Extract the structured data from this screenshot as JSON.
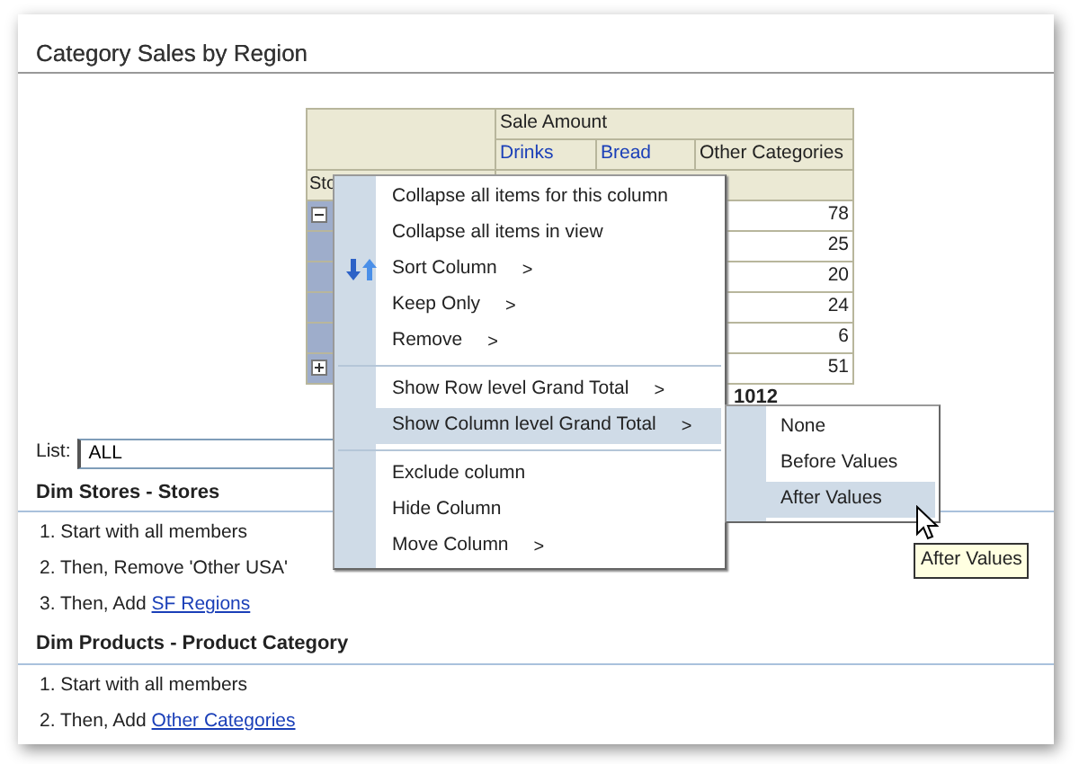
{
  "panel": {
    "title": "Category Sales by Region"
  },
  "table": {
    "measure": "Sale Amount",
    "columns": [
      {
        "label": "Drinks",
        "link": true
      },
      {
        "label": "Bread",
        "link": true
      },
      {
        "label": "Other Categories",
        "link": false
      }
    ],
    "row_header": "Sto",
    "rows": [
      {
        "kind": "group",
        "expanded": true,
        "value": "78"
      },
      {
        "kind": "member",
        "value": "25"
      },
      {
        "kind": "member",
        "value": "20"
      },
      {
        "kind": "member",
        "value": "24"
      },
      {
        "kind": "member",
        "value": "6"
      },
      {
        "kind": "group",
        "expanded": false,
        "value": "51"
      }
    ],
    "grand_total": "1012"
  },
  "list": {
    "label": "List:",
    "value": "ALL"
  },
  "sections": [
    {
      "title": "Dim Stores - Stores",
      "steps": [
        {
          "text": "1. Start with all members"
        },
        {
          "text": "2. Then, Remove 'Other USA'"
        },
        {
          "text": "3. Then, Add",
          "link": "SF Regions"
        }
      ]
    },
    {
      "title": "Dim Products - Product Category",
      "steps": [
        {
          "text": "1. Start with all members"
        },
        {
          "text": "2. Then, Add",
          "link": "Other Categories"
        }
      ]
    }
  ],
  "context_menu": {
    "groups": [
      [
        {
          "label": "Collapse all items for this column",
          "submenu": false,
          "selected": false
        },
        {
          "label": "Collapse all items in view",
          "submenu": false,
          "selected": false
        },
        {
          "label": "Sort Column",
          "submenu": true,
          "selected": false,
          "kind": "sort"
        },
        {
          "label": "Keep Only",
          "submenu": true,
          "selected": false
        },
        {
          "label": "Remove",
          "submenu": true,
          "selected": false
        }
      ],
      [
        {
          "label": "Show Row level Grand Total",
          "submenu": true,
          "selected": false
        },
        {
          "label": "Show Column level Grand Total",
          "submenu": true,
          "selected": true
        }
      ],
      [
        {
          "label": "Exclude column",
          "submenu": false,
          "selected": false
        },
        {
          "label": "Hide Column",
          "submenu": false,
          "selected": false
        },
        {
          "label": "Move Column",
          "submenu": true,
          "selected": false
        }
      ]
    ],
    "arrow": ">"
  },
  "submenu": {
    "items": [
      {
        "label": "None",
        "selected": false
      },
      {
        "label": "Before Values",
        "selected": false
      },
      {
        "label": "After Values",
        "selected": true
      }
    ]
  },
  "tooltip": "After Values"
}
